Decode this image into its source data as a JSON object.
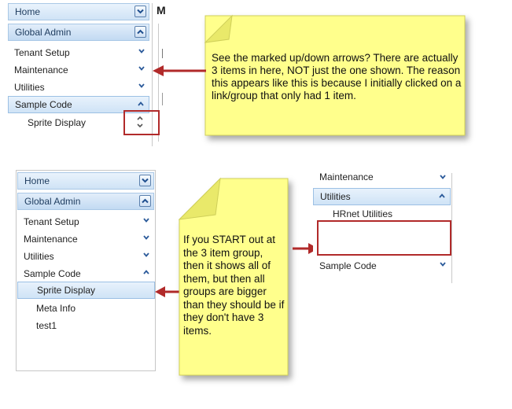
{
  "top_panel": {
    "home": "Home",
    "global_admin": "Global Admin",
    "items": [
      "Tenant Setup",
      "Maintenance",
      "Utilities",
      "Sample Code"
    ],
    "sub_item": "Sprite Display",
    "truncated_title": "M"
  },
  "note_top": {
    "text": "See the marked up/down arrows?  There are actually 3 items in here, NOT just the one shown.  The reason this appears like this is because I initially clicked on a link/group that only had 1 item."
  },
  "bottom_panel": {
    "home": "Home",
    "global_admin": "Global Admin",
    "items": [
      "Tenant Setup",
      "Maintenance",
      "Utilities",
      "Sample Code"
    ],
    "sub_items": [
      "Sprite Display",
      "Meta Info",
      "test1"
    ]
  },
  "note_bottom": {
    "text": "If you START out at the 3 item group, then it shows all of them, but then all groups are bigger than they should be if they don't have 3 items."
  },
  "right_panel": {
    "maintenance": "Maintenance",
    "utilities": "Utilities",
    "sub_item": "HRnet Utilities",
    "sample_code": "Sample Code"
  },
  "colors": {
    "header_border": "#a9c8e6",
    "note_fill": "#ffff8c",
    "arrow": "#b12a2a",
    "chevron": "#2b5a9a"
  }
}
